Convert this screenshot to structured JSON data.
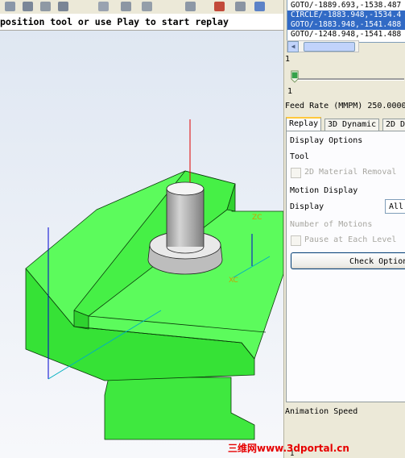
{
  "colors": {
    "part_face": "#45f545",
    "part_edge": "#0a3a0a",
    "selection": "#316ac5",
    "watermark": "#e60000"
  },
  "toolbar": {
    "icons": [
      "toolbar-icon",
      "toolbar-icon",
      "toolbar-icon",
      "toolbar-icon",
      "toolbar-icon",
      "toolbar-icon",
      "toolbar-icon",
      "toolbar-icon",
      "toolbar-icon",
      "toolbar-icon"
    ]
  },
  "prompt": "position tool or use Play to start replay",
  "viewport": {
    "axis_labels": {
      "zc": "ZC",
      "xc": "XC"
    }
  },
  "path_list": [
    "GOTO/-1889.693,-1538.487",
    "CIRCLE/-1883.948,-1534.4",
    "GOTO/-1883.948,-1541.488",
    "GOTO/-1248.948,-1541.488"
  ],
  "list_position": "1",
  "slider": {
    "value": "1"
  },
  "feed_rate": "Feed Rate (MMPM) 250.0000",
  "tabs": [
    "Replay",
    "3D Dynamic",
    "2D D"
  ],
  "replay": {
    "display_options": "Display Options",
    "tool": "Tool",
    "material_removal": "2D Material Removal",
    "motion_display": "Motion Display",
    "display_label": "Display",
    "display_value": "All",
    "number_of_motions": "Number of Motions",
    "pause_each_level": "Pause at Each Level",
    "check_options": "Check Options"
  },
  "animation_speed": "Animation Speed",
  "bottom_value": "1",
  "watermark": "三维网www.3dportal.cn"
}
